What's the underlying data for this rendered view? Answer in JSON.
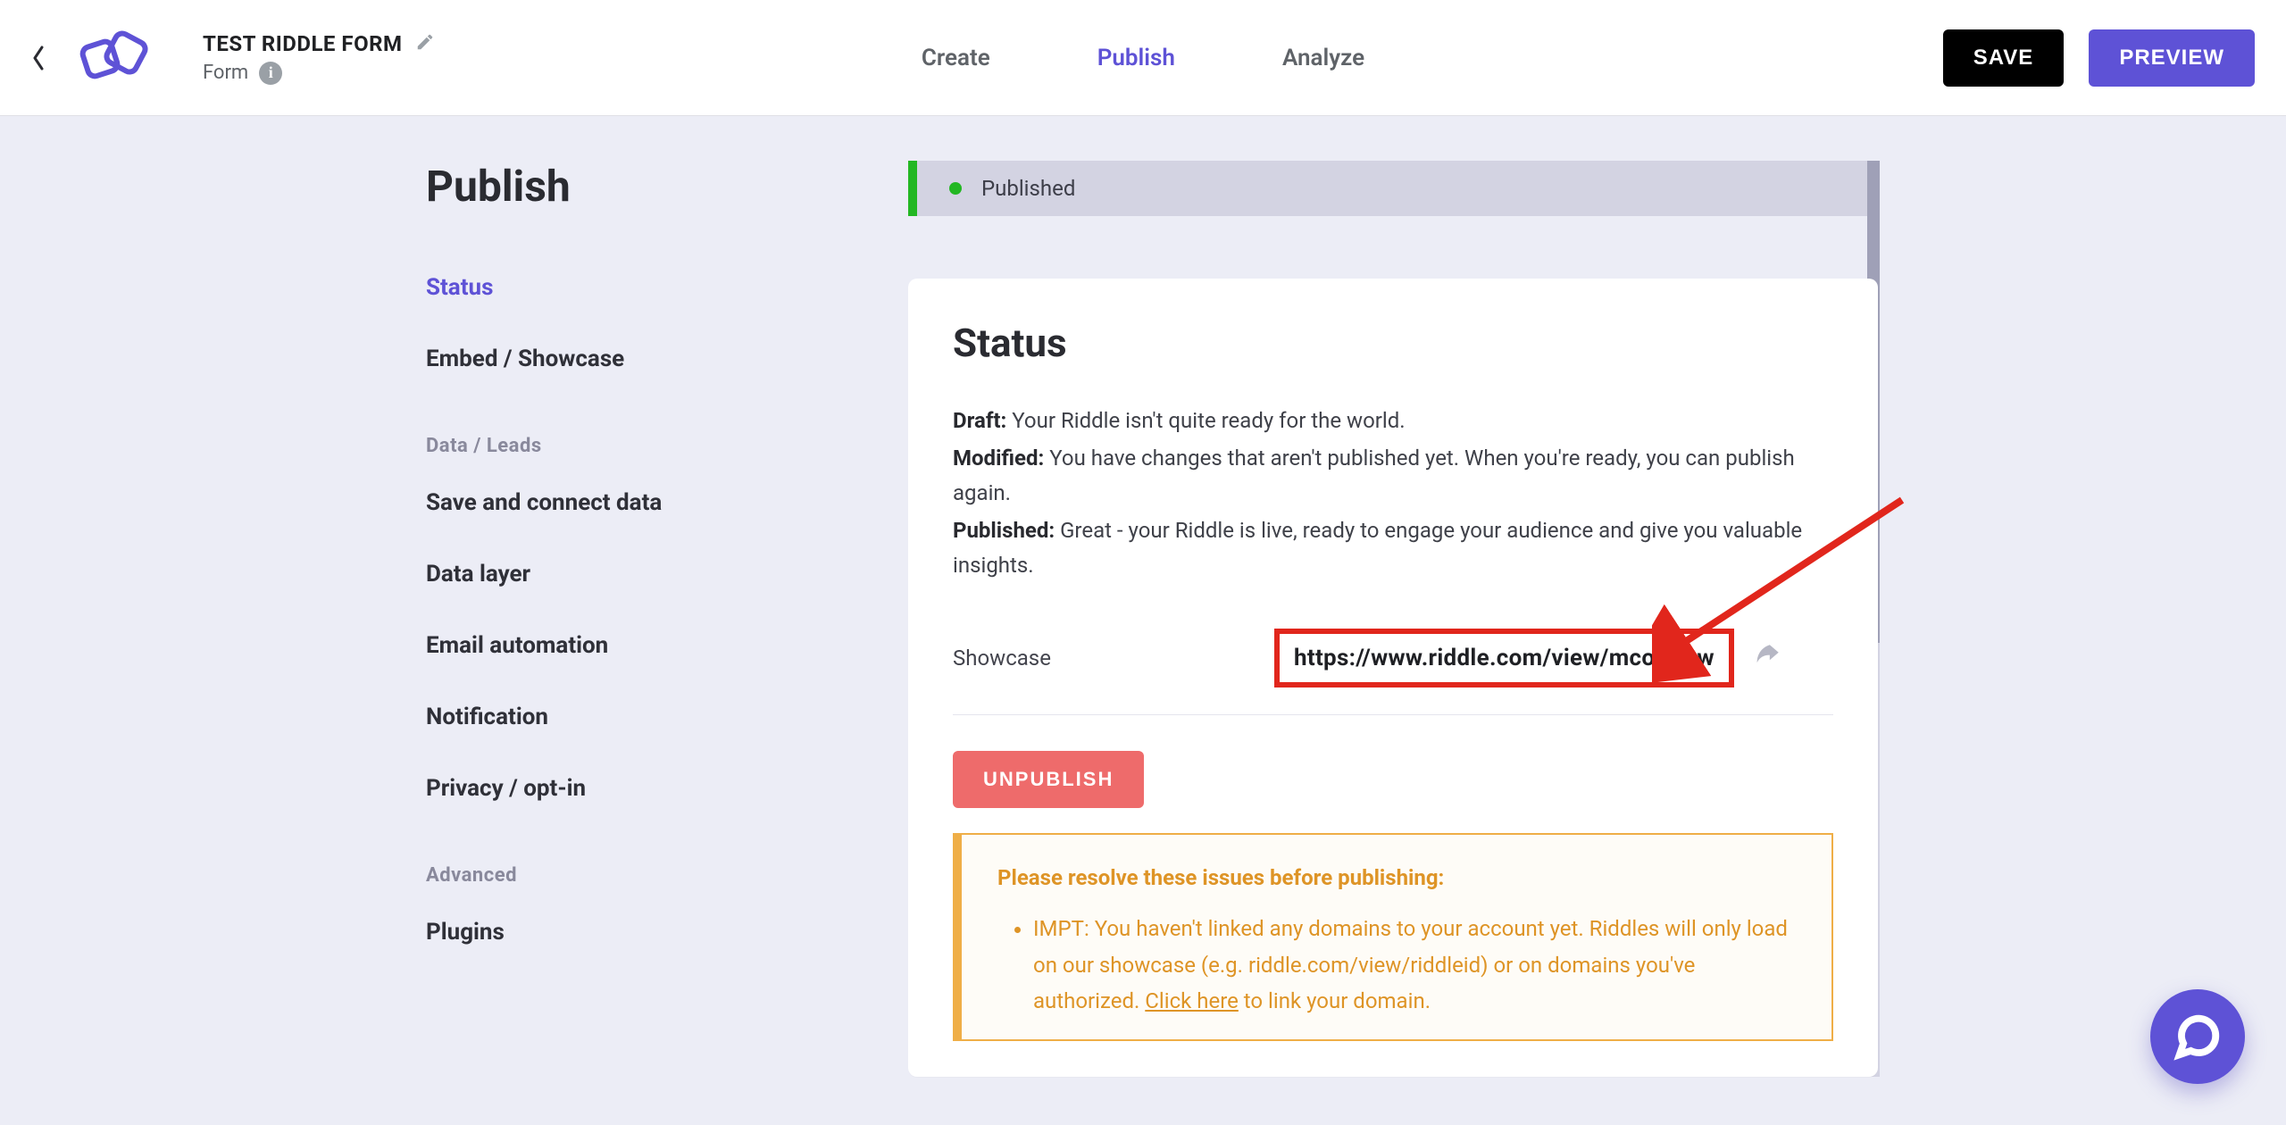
{
  "header": {
    "title": "TEST RIDDLE FORM",
    "type_label": "Form",
    "tabs": {
      "create": "Create",
      "publish": "Publish",
      "analyze": "Analyze"
    },
    "active_tab": "publish",
    "save_label": "SAVE",
    "preview_label": "PREVIEW"
  },
  "sidebar": {
    "heading": "Publish",
    "items": [
      {
        "label": "Status"
      },
      {
        "label": "Embed / Showcase"
      }
    ],
    "section_data_label": "Data / Leads",
    "data_items": [
      {
        "label": "Save and connect data"
      },
      {
        "label": "Data layer"
      },
      {
        "label": "Email automation"
      },
      {
        "label": "Notification"
      },
      {
        "label": "Privacy / opt-in"
      }
    ],
    "section_advanced_label": "Advanced",
    "advanced_items": [
      {
        "label": "Plugins"
      }
    ],
    "active_item": "Status"
  },
  "status_banner": {
    "label": "Published"
  },
  "card": {
    "title": "Status",
    "draft_label": "Draft:",
    "draft_text": "Your Riddle isn't quite ready for the world.",
    "modified_label": "Modified:",
    "modified_text": "You have changes that aren't published yet. When you're ready, you can publish again.",
    "published_label": "Published:",
    "published_text": "Great - your Riddle is live, ready to engage your audience and give you valuable insights.",
    "showcase_label": "Showcase",
    "showcase_url": "https://www.riddle.com/view/mcojIDow",
    "unpublish_label": "UNPUBLISH",
    "warning_title": "Please resolve these issues before publishing:",
    "warning_item_prefix": "IMPT: You haven't linked any domains to your account yet. Riddles will only load on our showcase (e.g. riddle.com/view/riddleid) or on domains you've authorized. ",
    "warning_link_text": "Click here",
    "warning_item_suffix": " to link your domain."
  }
}
